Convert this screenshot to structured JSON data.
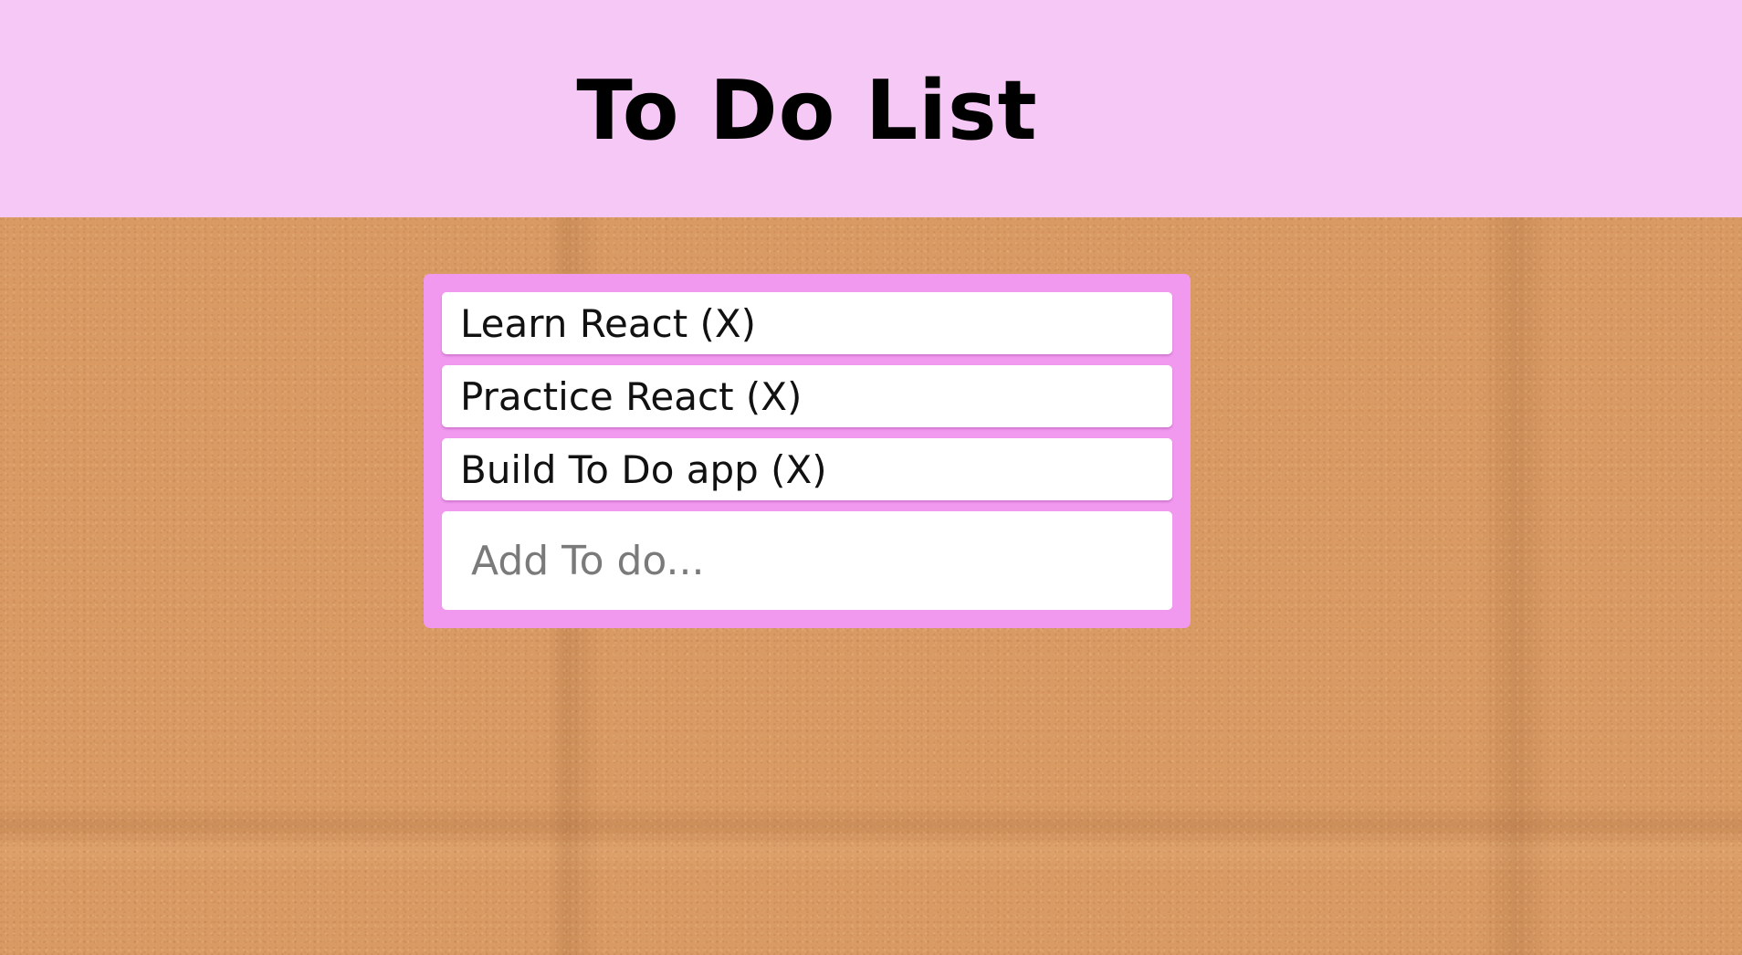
{
  "header": {
    "title": "To Do List"
  },
  "todos": [
    {
      "label": "Learn React (X)"
    },
    {
      "label": "Practice React (X)"
    },
    {
      "label": "Build To Do app (X)"
    }
  ],
  "add_input": {
    "placeholder": "Add To do...",
    "value": ""
  },
  "colors": {
    "header_background": "#f6c8f5",
    "panel_background": "#f199ef",
    "item_background": "#ffffff",
    "board_background": "#d99a63"
  }
}
